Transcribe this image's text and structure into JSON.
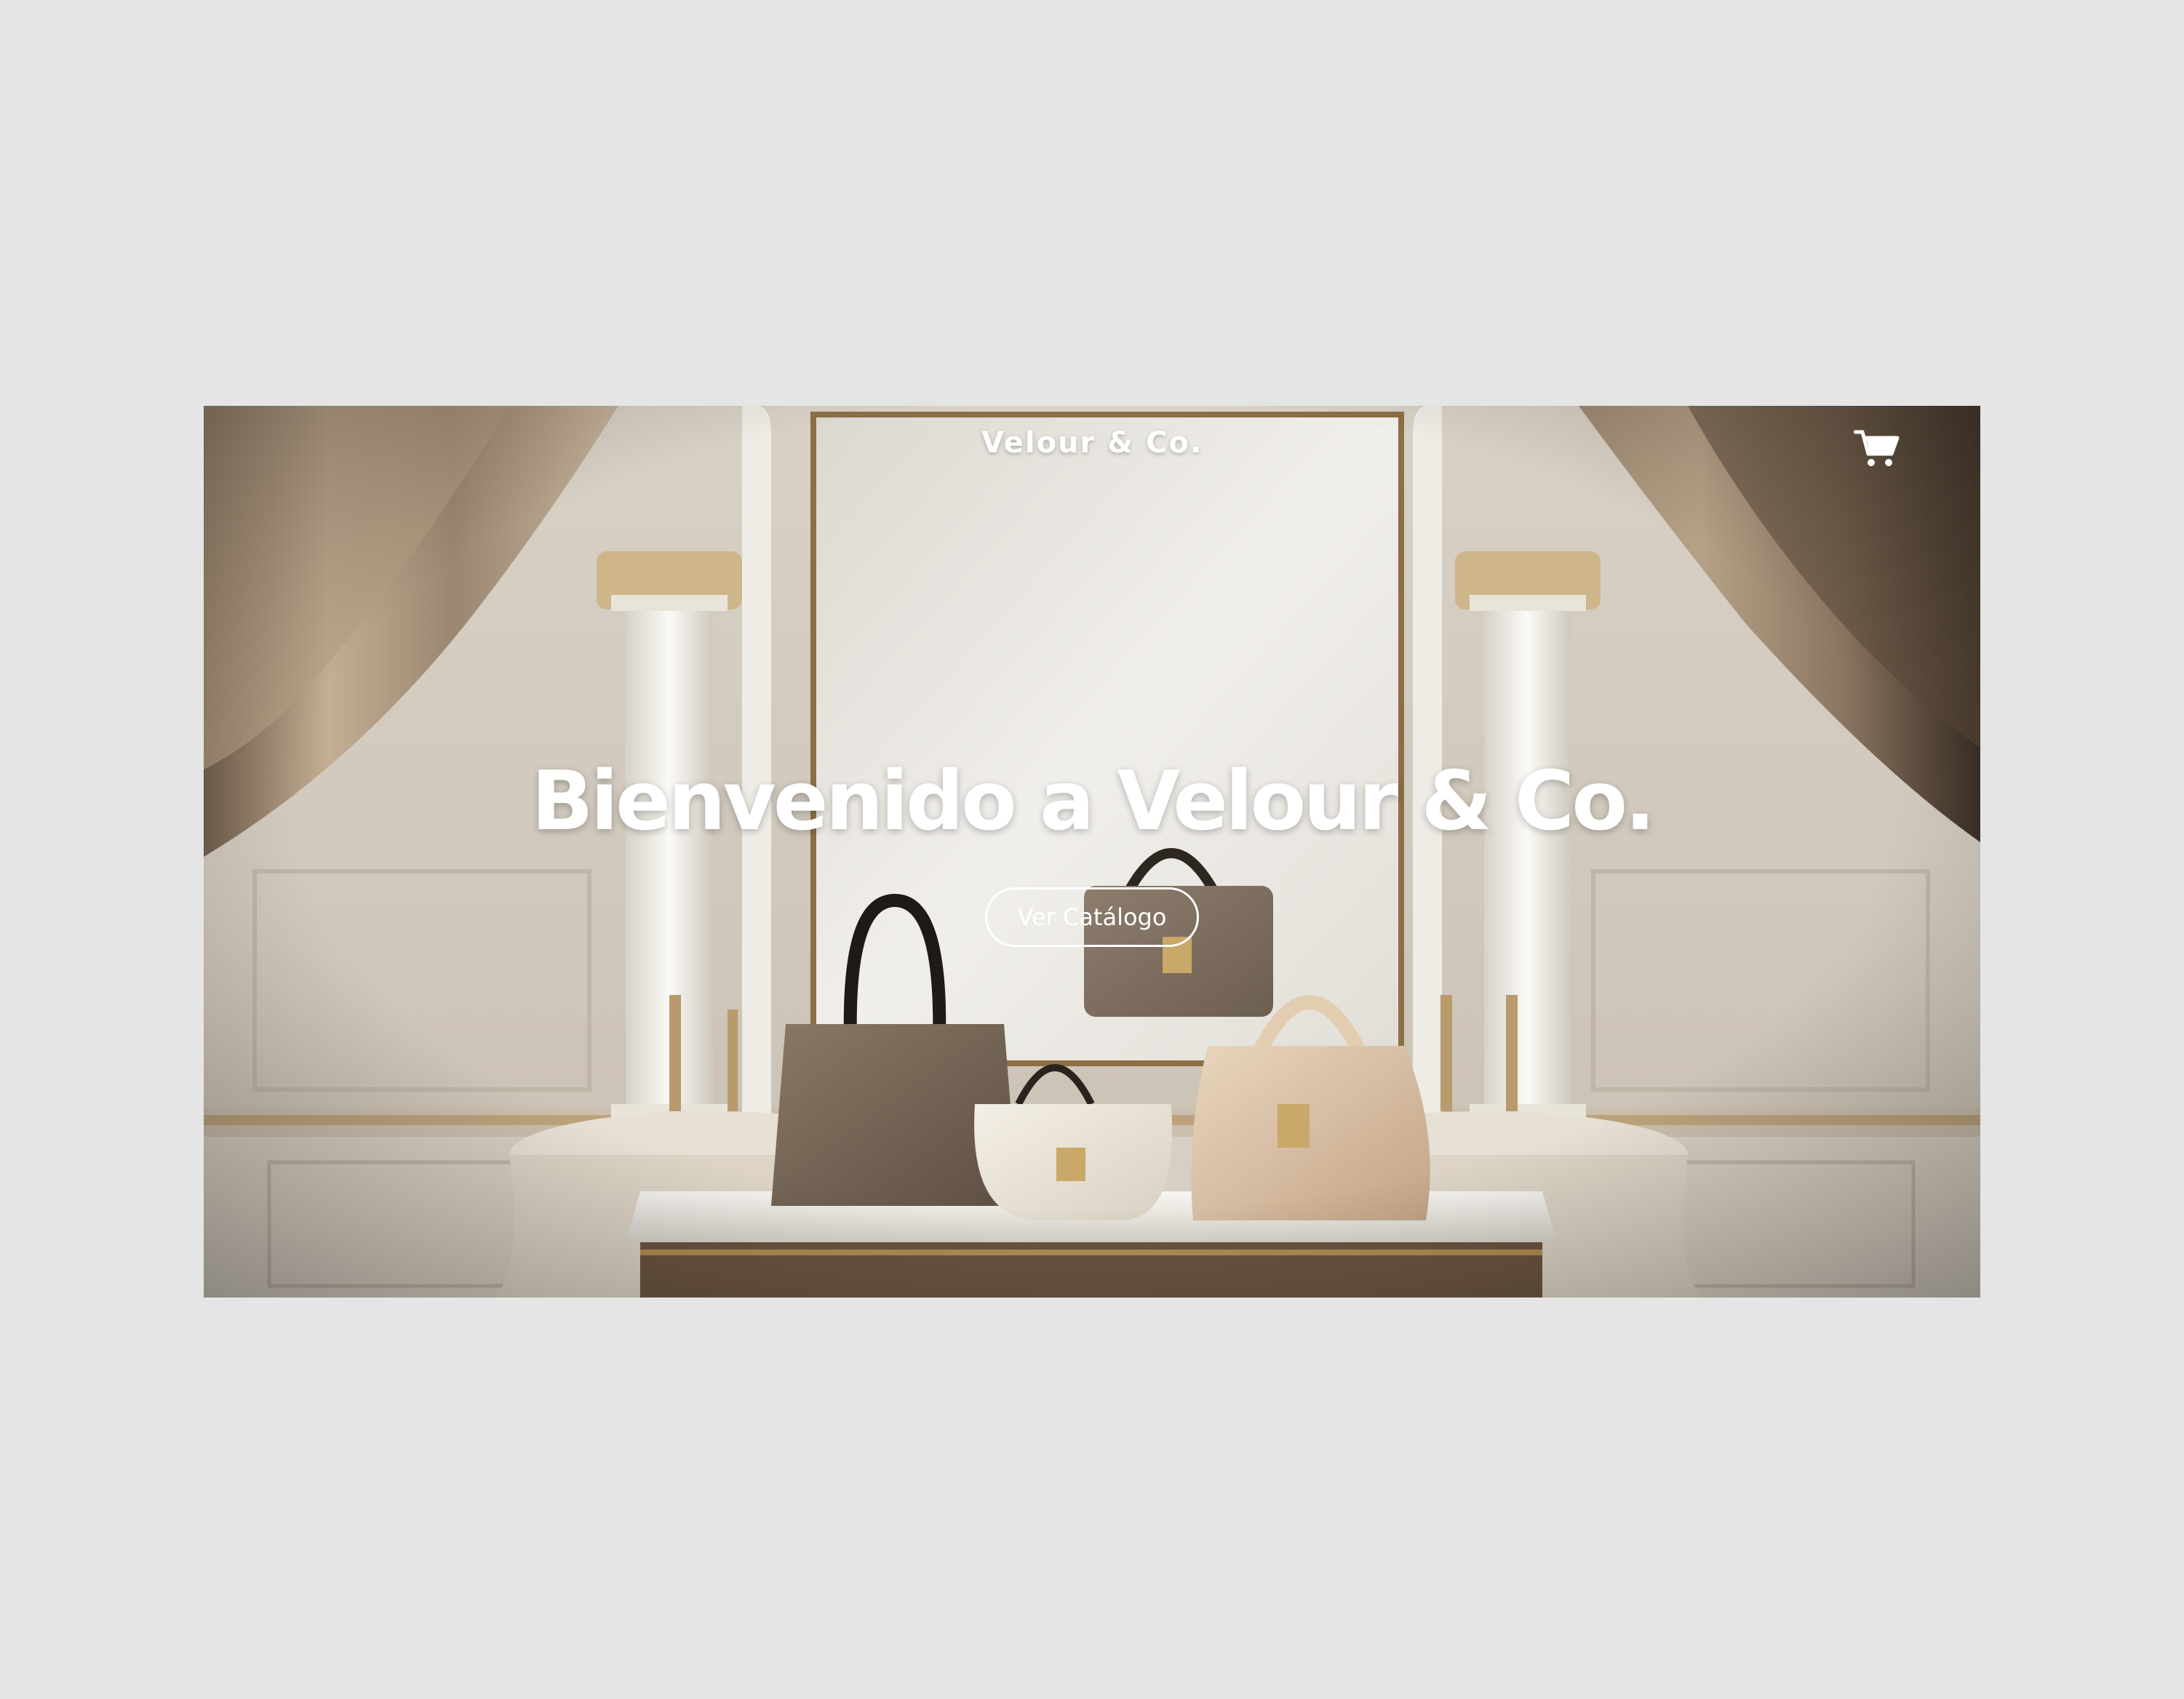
{
  "header": {
    "brand": "Velour & Co.",
    "cart_icon": "shopping-cart-icon"
  },
  "hero": {
    "headline": "Bienvenido a Velour & Co.",
    "cta_label": "Ver Catálogo",
    "background": "luxury-handbag-showroom-image"
  },
  "colors": {
    "page_bg": "#e5e5e5",
    "text": "#ffffff",
    "curtain": "#a8927a",
    "wall": "#e4dfd6",
    "gold": "#b38d55"
  }
}
